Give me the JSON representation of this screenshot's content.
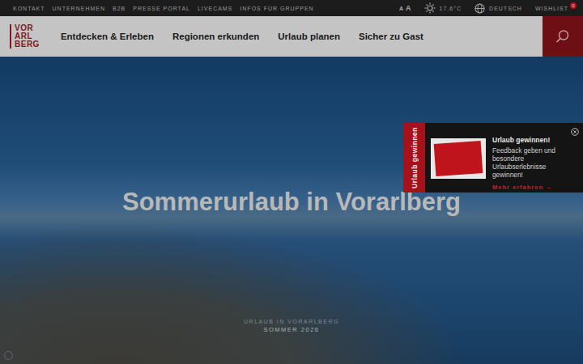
{
  "top_bar": {
    "links": [
      "KONTAKT",
      "UNTERNEHMEN",
      "B2B",
      "PRESSE PORTAL",
      "LIVECAMS",
      "INFOS FÜR GRUPPEN"
    ],
    "font_sizes": [
      "A",
      "A"
    ],
    "temperature": "17.6°C",
    "language": "DEUTSCH",
    "wishlist": {
      "label": "WISHLIST",
      "count": "0"
    }
  },
  "logo": {
    "lines": [
      "VOR",
      "ARL",
      "BERG"
    ]
  },
  "nav": {
    "items": [
      "Entdecken & Erleben",
      "Regionen erkunden",
      "Urlaub planen",
      "Sicher zu Gast"
    ]
  },
  "hero": {
    "title": "Sommerurlaub in Vorarlberg",
    "kicker": "URLAUB IN VORARLBERG",
    "season": "SOMMER 2026"
  },
  "promo": {
    "tab": "Urlaub gewinnen",
    "title": "Urlaub gewinnen!",
    "text": "Feedback geben und besondere Urlaubserlebnisse gewinnen!",
    "link": "Mehr erfahren",
    "link_icon": "→"
  }
}
